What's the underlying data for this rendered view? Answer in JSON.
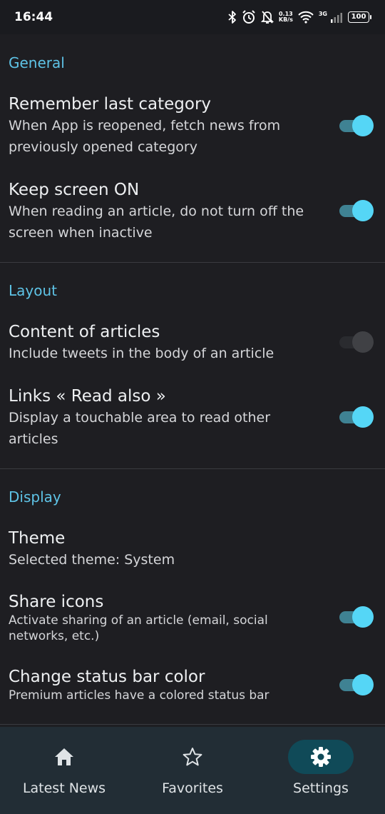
{
  "status_bar": {
    "time": "16:44",
    "net_speed_value": "0.13",
    "net_speed_unit": "KB/s",
    "network_gen": "3G",
    "battery": "100",
    "icons": [
      "bluetooth-icon",
      "alarm-icon",
      "bell-off-icon",
      "wifi-icon",
      "signal-icon",
      "battery-icon"
    ]
  },
  "sections": {
    "general": "General",
    "layout": "Layout",
    "display": "Display"
  },
  "settings": {
    "remember_category": {
      "title": "Remember last category",
      "subtitle": "When App is reopened, fetch news from previously opened category",
      "enabled": true
    },
    "keep_screen_on": {
      "title": "Keep screen ON",
      "subtitle": "When reading an article, do not turn off the screen when inactive",
      "enabled": true
    },
    "content_of_articles": {
      "title": "Content of articles",
      "subtitle": "Include tweets in the body of an article",
      "enabled": false
    },
    "links_read_also": {
      "title": "Links « Read also »",
      "subtitle": "Display a touchable area to read other articles",
      "enabled": true
    },
    "theme": {
      "title": "Theme",
      "subtitle": "Selected theme: System"
    },
    "share_icons": {
      "title": "Share icons",
      "subtitle": "Activate sharing of an article (email, social networks, etc.)",
      "enabled": true
    },
    "status_bar_color": {
      "title": "Change status bar color",
      "subtitle": "Premium articles have a colored status bar",
      "enabled": true
    }
  },
  "bottom_nav": {
    "latest_news": "Latest News",
    "favorites": "Favorites",
    "settings": "Settings",
    "active": "settings"
  },
  "colors": {
    "accent": "#5ec3e6",
    "toggle_on_thumb": "#55d6f6",
    "toggle_on_track": "#3f8293",
    "background": "#1e1e22",
    "nav_background": "#222d35",
    "nav_active_pill": "#104a58"
  }
}
